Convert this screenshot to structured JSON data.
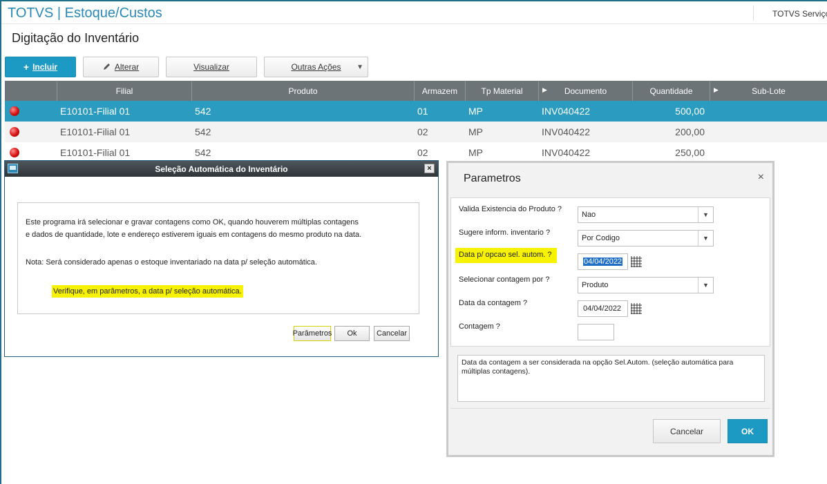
{
  "header": {
    "app_title": "TOTVS | Estoque/Custos",
    "company": "TOTVS Serviços"
  },
  "page": {
    "title": "Digitação do Inventário"
  },
  "toolbar": {
    "incluir_icon": "+",
    "incluir": "Incluir",
    "alterar_icon": "pencil-icon",
    "alterar": "Alterar",
    "visualizar": "Visualizar",
    "outras": "Outras Ações"
  },
  "grid": {
    "columns": [
      "",
      "Filial",
      "Produto",
      "Armazem",
      "Tp Material",
      "Documento",
      "Quantidade",
      "Sub-Lote"
    ],
    "rows": [
      {
        "status": "red",
        "filial": "E10101-Filial 01",
        "produto": "542",
        "armazem": "01",
        "tp": "MP",
        "documento": "INV040422",
        "quantidade": "500,00",
        "sublote": ""
      },
      {
        "status": "red",
        "filial": "E10101-Filial 01",
        "produto": "542",
        "armazem": "02",
        "tp": "MP",
        "documento": "INV040422",
        "quantidade": "200,00",
        "sublote": ""
      },
      {
        "status": "red",
        "filial": "E10101-Filial 01",
        "produto": "542",
        "armazem": "02",
        "tp": "MP",
        "documento": "INV040422",
        "quantidade": "250,00",
        "sublote": ""
      }
    ]
  },
  "dialog_selecao": {
    "title": "Seleção Automática do Inventário",
    "close": "×",
    "line1": "Este programa irá selecionar e gravar contagens como OK, quando houverem múltiplas contagens",
    "line2": "e dados de quantidade, lote e endereço estiverem iguais em contagens do mesmo produto na data.",
    "line3": "Nota: Será considerado apenas o estoque inventariado na data p/ seleção automática.",
    "line4": "Verifique, em parâmetros, a data p/ seleção automática.",
    "btn_parametros": "Parâmetros",
    "btn_ok": "Ok",
    "btn_cancelar": "Cancelar"
  },
  "dialog_parametros": {
    "title": "Parametros",
    "close": "×",
    "fields": {
      "valida_label": "Valida Existencia do Produto ?",
      "valida_value": "Nao",
      "sugere_label": "Sugere inform. inventario ?",
      "sugere_value": "Por Codigo",
      "data_sel_label": "Data p/ opcao sel. autom. ?",
      "data_sel_value": "04/04/2022",
      "selecionar_label": "Selecionar contagem por ?",
      "selecionar_value": "Produto",
      "data_contagem_label": "Data da contagem ?",
      "data_contagem_value": "04/04/2022",
      "contagem_label": "Contagem ?",
      "contagem_value": ""
    },
    "help_text": "Data da contagem a ser considerada na  opção Sel.Autom. (seleção automática para múltiplas contagens).",
    "btn_cancelar": "Cancelar",
    "btn_ok": "OK"
  },
  "colors": {
    "accent": "#1d9ac4",
    "highlight": "#f7f300",
    "header_gray": "#6d7478"
  }
}
